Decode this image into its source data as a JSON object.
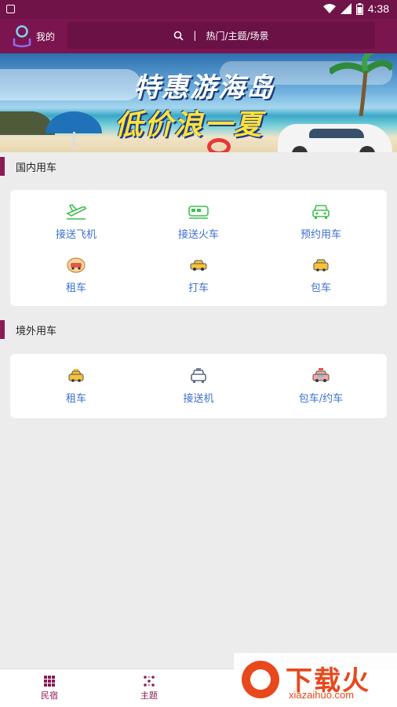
{
  "status_bar": {
    "time": "4:38"
  },
  "header": {
    "me_label": "我的",
    "search_separator": "|",
    "search_placeholder": "热门/主题/场景"
  },
  "banner": {
    "headline": "特惠游海岛",
    "subline": "低价浪一夏"
  },
  "domestic": {
    "title": "国内用车",
    "items": [
      {
        "label": "接送飞机",
        "icon": "airplane-icon"
      },
      {
        "label": "接送火车",
        "icon": "train-icon"
      },
      {
        "label": "预约用车",
        "icon": "car-icon"
      },
      {
        "label": "租车",
        "icon": "rental-car-icon"
      },
      {
        "label": "打车",
        "icon": "taxi-icon"
      },
      {
        "label": "包车",
        "icon": "charter-car-icon"
      }
    ]
  },
  "overseas": {
    "title": "境外用车",
    "items": [
      {
        "label": "租车",
        "icon": "taxi-icon"
      },
      {
        "label": "接送机",
        "icon": "shuttle-car-icon"
      },
      {
        "label": "包车/约车",
        "icon": "charter-car-icon"
      }
    ]
  },
  "bottom_nav": {
    "items": [
      {
        "label": "民宿",
        "icon": "grid-icon"
      },
      {
        "label": "主题",
        "icon": "dots-icon"
      }
    ]
  },
  "watermark": {
    "text": "下载火",
    "url": "xiazaihuo.com"
  },
  "colors": {
    "primary": "#7a1550",
    "accent_bar": "#8b1a55",
    "label_blue": "#3c6fd0",
    "icon_green": "#3fbf4f"
  }
}
